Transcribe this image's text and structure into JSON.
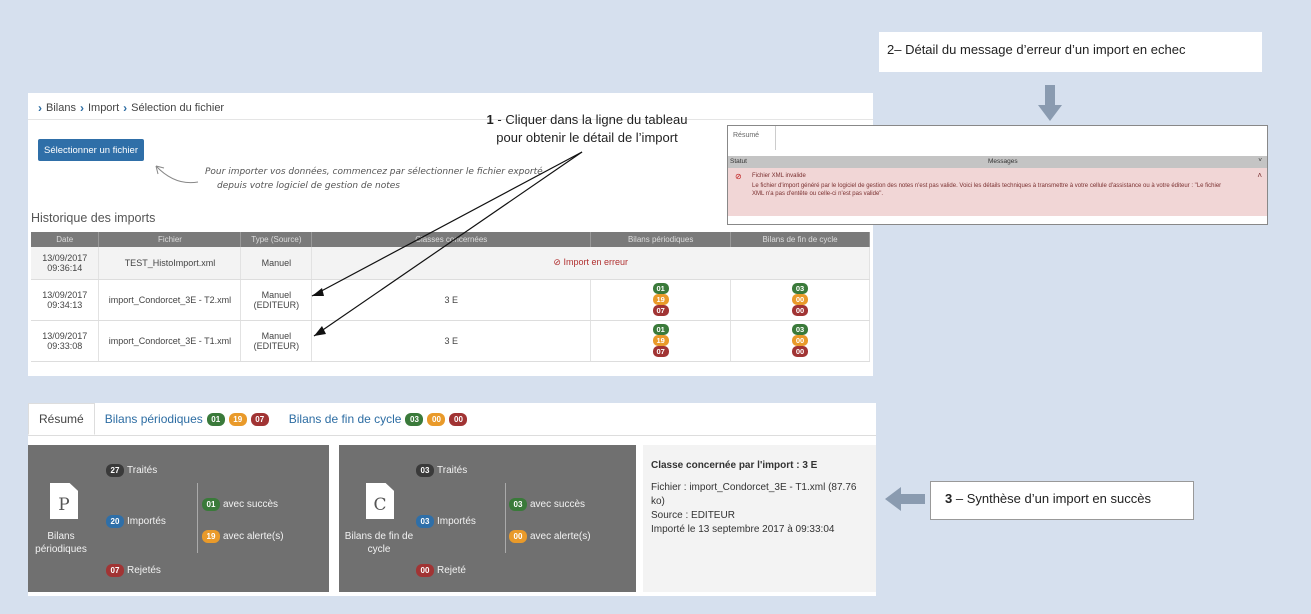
{
  "breadcrumb": {
    "items": [
      "Bilans",
      "Import",
      "Sélection du fichier"
    ]
  },
  "select_button": "Sélectionner un fichier",
  "hint_lines": [
    "Pour importer vos données, commencez par sélectionner le fichier exporté",
    "depuis votre logiciel de gestion de notes"
  ],
  "history": {
    "title": "Historique des imports",
    "columns": [
      "Date",
      "Fichier",
      "Type (Source)",
      "Classes concernées",
      "Bilans périodiques",
      "Bilans de fin de cycle"
    ],
    "rows": [
      {
        "date": "13/09/2017",
        "time": "09:36:14",
        "file": "TEST_HistoImport.xml",
        "type1": "Manuel",
        "type2": "",
        "status": "⊘ Import en erreur"
      },
      {
        "date": "13/09/2017",
        "time": "09:34:13",
        "file": "import_Condorcet_3E - T2.xml",
        "type1": "Manuel",
        "type2": "(EDITEUR)",
        "classes": "3 E",
        "bp": [
          "01",
          "19",
          "07"
        ],
        "bfc": [
          "03",
          "00",
          "00"
        ]
      },
      {
        "date": "13/09/2017",
        "time": "09:33:08",
        "file": "import_Condorcet_3E - T1.xml",
        "type1": "Manuel",
        "type2": "(EDITEUR)",
        "classes": "3 E",
        "bp": [
          "01",
          "19",
          "07"
        ],
        "bfc": [
          "03",
          "00",
          "00"
        ]
      }
    ]
  },
  "annot1": {
    "num": "1",
    "line1": " - Cliquer dans la ligne du tableau",
    "line2": "pour obtenir le détail de l’import"
  },
  "annot2": {
    "text": "2– Détail du message d’erreur d’un import en echec"
  },
  "annot3": {
    "num": "3",
    "text": " – Synthèse d’un import en succès"
  },
  "detail": {
    "tab": "Résumé",
    "col_statut": "Statut",
    "col_messages": "Messages",
    "title": "Fichier XML invalide",
    "body": "Le fichier d'import généré par le logiciel de gestion des notes n'est pas valide. Voici les détails techniques à transmettre à votre cellule d'assistance ou à votre éditeur : \"Le fichier XML n'a pas d'entête ou celle-ci n'est pas valide\"."
  },
  "tabs": {
    "resume": "Résumé",
    "bp": "Bilans périodiques",
    "bp_pills": [
      "01",
      "19",
      "07"
    ],
    "bfc": "Bilans de fin de cycle",
    "bfc_pills": [
      "03",
      "00",
      "00"
    ]
  },
  "card_bp": {
    "letter": "P",
    "label1": "Bilans",
    "label2": "périodiques",
    "traites_n": "27",
    "traites": "Traités",
    "importes_n": "20",
    "importes": "Importés",
    "rejetes_n": "07",
    "rejetes": "Rejetés",
    "succes_n": "01",
    "succes": "avec succès",
    "alertes_n": "19",
    "alertes": "avec alerte(s)"
  },
  "card_bfc": {
    "letter": "C",
    "label1": "Bilans de fin de",
    "label2": "cycle",
    "traites_n": "03",
    "traites": "Traités",
    "importes_n": "03",
    "importes": "Importés",
    "rejetes_n": "00",
    "rejetes": "Rejeté",
    "succes_n": "03",
    "succes": "avec succès",
    "alertes_n": "00",
    "alertes": "avec alerte(s)"
  },
  "summary": {
    "classe": "Classe concernée par l'import : 3 E",
    "fichier": "Fichier : import_Condorcet_3E - T1.xml (87.76 ko)",
    "source": "Source : EDITEUR",
    "importe": "Importé le 13 septembre 2017 à 09:33:04"
  },
  "colors": {
    "green": "#3a7a3a",
    "orange": "#e99a2a",
    "red": "#a13434",
    "blue": "#2f6fa8"
  }
}
